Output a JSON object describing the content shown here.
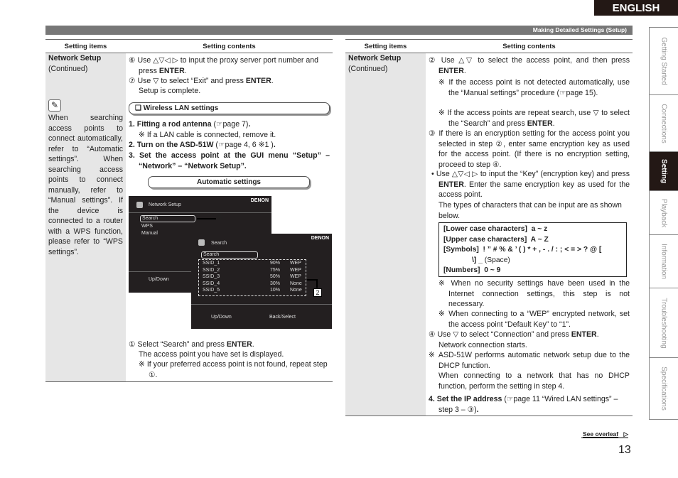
{
  "language_label": "ENGLISH",
  "header_title": "Making Detailed Settings (Setup)",
  "page_number": "13",
  "see_overleaf": "See overleaf",
  "side_tabs": [
    {
      "label": "Getting Started",
      "active": false
    },
    {
      "label": "Connections",
      "active": false
    },
    {
      "label": "Setting",
      "active": true
    },
    {
      "label": "Playback",
      "active": false
    },
    {
      "label": "Information",
      "active": false
    },
    {
      "label": "Troubleshooting",
      "active": false
    },
    {
      "label": "Specifications",
      "active": false
    }
  ],
  "left": {
    "col_items": "Setting items",
    "col_contents": "Setting contents",
    "item_title": "Network Setup",
    "item_sub": "(Continued)",
    "note_icon": "pencil-icon",
    "note": "When searching access points to connect automatically, refer to “Automatic settings”. When searching access points to connect manually, refer to “Manual settings”. If the device is connected to a router with a WPS function, please refer to “WPS settings”.",
    "p1": [
      [
        "⑥ Use △▽◁ ▷ to input the proxy server port number and press ",
        0
      ],
      [
        "ENTER",
        1
      ],
      [
        ".",
        0
      ]
    ],
    "p2": [
      [
        "⑦ Use ▽ to select “Exit” and press ",
        0
      ],
      [
        "ENTER",
        1
      ],
      [
        ".",
        0
      ]
    ],
    "p2b": "Setup is complete.",
    "wireless_title": "❑ Wireless LAN settings",
    "s1": [
      [
        "1. Fitting a rod antenna",
        1
      ],
      [
        " (☞page 7)",
        0
      ],
      [
        ".",
        1
      ]
    ],
    "s1n": "※ If a LAN cable is connected, remove it.",
    "s2": [
      [
        "2. Turn on the ASD-51W",
        1
      ],
      [
        " (☞page 4, 6 ※1 )",
        0
      ],
      [
        ".",
        1
      ]
    ],
    "s3": [
      [
        "3. Set the access point at the GUI menu “Setup” – “Network” – “Network Setup”.",
        1
      ]
    ],
    "auto_title": "Automatic settings",
    "screen1": {
      "title": "Network Setup",
      "brand": "DENON",
      "items": [
        "Search",
        "WPS",
        "Manual"
      ],
      "footer": "Up/Down",
      "callout": "①"
    },
    "screen2": {
      "title": "Search",
      "brand": "DENON",
      "selected": "Search",
      "rows": [
        [
          "SSID_1",
          "90%",
          "WEP"
        ],
        [
          "SSID_2",
          "75%",
          "WEP"
        ],
        [
          "SSID_3",
          "50%",
          "WEP"
        ],
        [
          "SSID_4",
          "30%",
          "None"
        ],
        [
          "SSID_5",
          "10%",
          "None"
        ]
      ],
      "footer1": "Up/Down",
      "footer2": "Back/Select",
      "callout": "2"
    },
    "f1": [
      [
        "① Select “Search” and press ",
        0
      ],
      [
        "ENTER",
        1
      ],
      [
        ".",
        0
      ]
    ],
    "f2": "The access point you have set is displayed.",
    "f3": "※ If your preferred access point is not found, repeat step ①."
  },
  "right": {
    "col_items": "Setting items",
    "col_contents": "Setting contents",
    "item_title": "Network Setup",
    "item_sub": "(Continued)",
    "r1": [
      [
        "② Use △▽ to select the access point, and then press ",
        0
      ],
      [
        "ENTER",
        1
      ],
      [
        ".",
        0
      ]
    ],
    "r1a": "※ If the access point is not detected automatically, use the “Manual settings” procedure (☞page 15).",
    "r1b": [
      [
        "※ If the access points are repeat search, use ▽ to select the “Search” and press ",
        0
      ],
      [
        "ENTER",
        1
      ],
      [
        ".",
        0
      ]
    ],
    "r2": "③ If there is an encryption setting for the access point you selected in step ②, enter same encryption key as used for the access point. (If there is no encryption setting, proceed to step ④.",
    "r3": [
      [
        "• Use △▽◁ ▷ to input the “Key” (encryption key) and press ",
        0
      ],
      [
        "ENTER",
        1
      ],
      [
        ". Enter the same encryption key as used for the access point.",
        0
      ]
    ],
    "r3b": "The types of characters that can be input are as shown below.",
    "chars": [
      [
        [
          "[Lower case characters]",
          1
        ],
        [
          "  a ~ z",
          1
        ]
      ],
      [
        [
          "[Upper case characters]",
          1
        ],
        [
          "  A ~ Z",
          1
        ]
      ],
      [
        [
          "[Symbols]",
          1
        ],
        [
          "  ! ” # % & ’ ( ) * + , - . / : ; < = > ? @ [",
          1
        ]
      ],
      [
        [
          "              \\] _",
          1
        ],
        [
          " (Space)",
          0
        ]
      ],
      [
        [
          "[Numbers]",
          1
        ],
        [
          "  0 ~ 9",
          1
        ]
      ]
    ],
    "r4": "※ When no security settings have been used in the Internet connection settings, this step is not necessary.",
    "r5": "※ When connecting to a “WEP” encrypted network, set the access point “Default Key” to “1”.",
    "r6": [
      [
        "④ Use ▽ to select “Connection” and press ",
        0
      ],
      [
        "ENTER",
        1
      ],
      [
        ".",
        0
      ]
    ],
    "r6b": "Network connection starts.",
    "r7": "※ ASD-51W performs automatic network setup due to the DHCP function.",
    "r7b": "When connecting to a network that has no DHCP function, perform the setting in step 4.",
    "r8": [
      [
        "4. Set the IP address",
        1
      ],
      [
        " (☞page 11 “Wired LAN settings” – step 3 – ③)",
        0
      ],
      [
        ".",
        1
      ]
    ]
  }
}
